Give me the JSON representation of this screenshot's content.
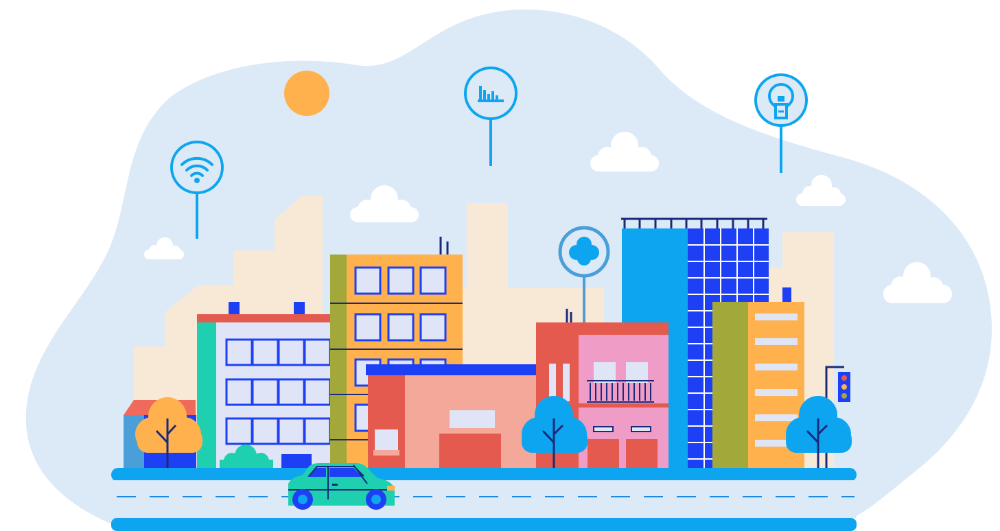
{
  "scene": {
    "subject": "smart-city",
    "colors": {
      "sky_blob": "#dceaf7",
      "skyline": "#f8e9d7",
      "sun": "#ffb14e",
      "pin": "#0ea5f0",
      "pin_cloud": "#4a9fd8",
      "road": "#0ea5f0",
      "road_surface": "#dceaf7",
      "road_dash": "#1e88e5",
      "cloud": "#ffffff",
      "car_body": "#1ecfb0",
      "car_wheel": "#1d3ee0",
      "tree_orange": "#ffb14e",
      "tree_blue": "#0ea5f0"
    },
    "icons": [
      "wifi-icon",
      "bar-chart-icon",
      "lightbulb-icon",
      "cloud-icon"
    ]
  }
}
